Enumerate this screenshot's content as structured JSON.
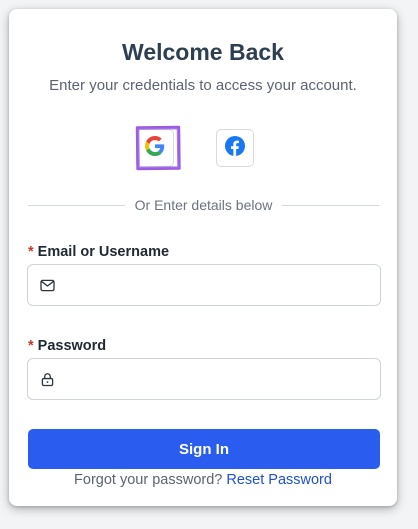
{
  "header": {
    "title": "Welcome Back",
    "subtitle": "Enter your credentials to access your account."
  },
  "social": {
    "google_icon": "google-icon",
    "facebook_icon": "facebook-icon"
  },
  "divider": {
    "text": "Or Enter details below"
  },
  "email": {
    "required_marker": "*",
    "label": "Email or Username",
    "value": "",
    "icon": "mail-icon"
  },
  "password": {
    "required_marker": "*",
    "label": "Password",
    "value": "",
    "icon": "lock-icon"
  },
  "signin": {
    "label": "Sign In"
  },
  "forgot": {
    "prompt": "Forgot your password?",
    "link": "Reset Password"
  },
  "colors": {
    "primary": "#2b5cf0",
    "link": "#1f4fd6",
    "required": "#c0392b",
    "highlight": "#9b5de5",
    "facebook": "#1877f2"
  }
}
